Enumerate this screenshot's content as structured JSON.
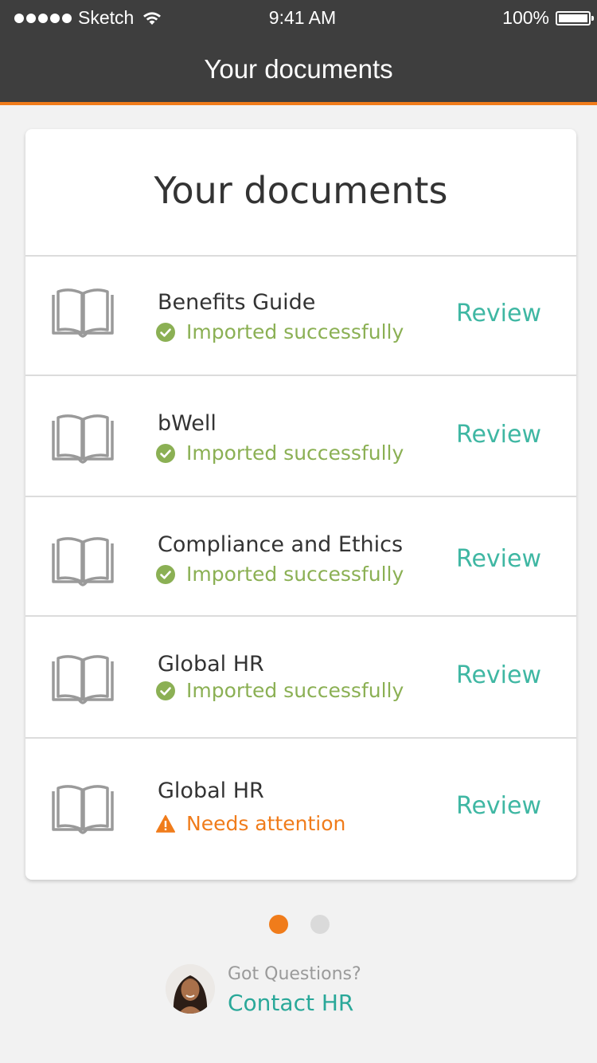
{
  "status_bar": {
    "carrier": "Sketch",
    "time": "9:41 AM",
    "battery": "100%"
  },
  "nav": {
    "title": "Your documents"
  },
  "card": {
    "title": "Your documents",
    "items": [
      {
        "name": "Benefits Guide",
        "status": "Imported successfully",
        "status_type": "success",
        "action": "Review"
      },
      {
        "name": "bWell",
        "status": "Imported successfully",
        "status_type": "success",
        "action": "Review"
      },
      {
        "name": "Compliance and Ethics",
        "status": "Imported successfully",
        "status_type": "success",
        "action": "Review"
      },
      {
        "name": "Global HR",
        "status": "Imported successfully",
        "status_type": "success",
        "action": "Review"
      },
      {
        "name": "Global HR",
        "status": "Needs attention",
        "status_type": "warning",
        "action": "Review"
      }
    ]
  },
  "pager": {
    "pages": 2,
    "active": 0
  },
  "help": {
    "question": "Got Questions?",
    "link": "Contact HR"
  },
  "colors": {
    "header_bg": "#3e3e3e",
    "accent": "#f07c1b",
    "success": "#8bb054",
    "warning": "#f07c1b",
    "link": "#3fb7a3",
    "dot_inactive": "#dadada"
  }
}
